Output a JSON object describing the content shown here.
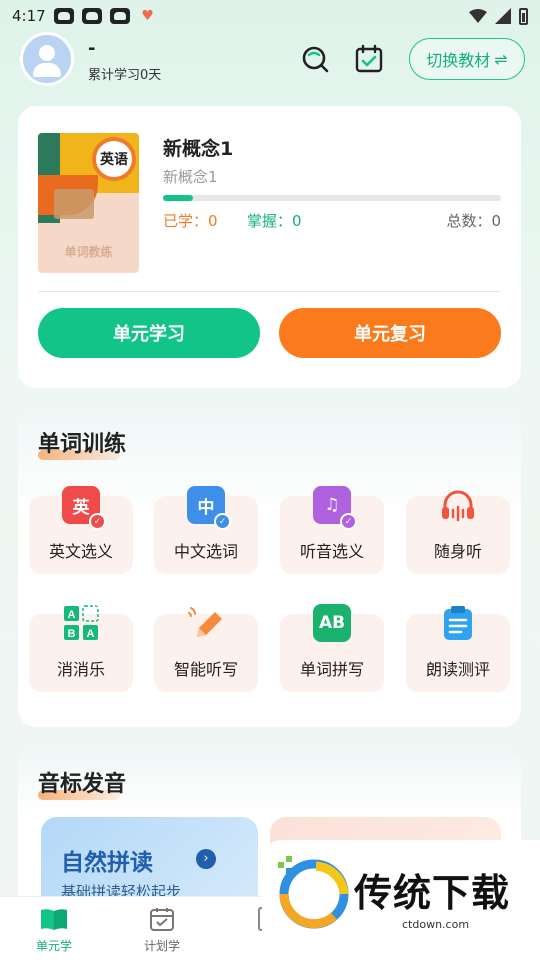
{
  "status_bar": {
    "time": "4:17",
    "heart_glyph": "♥"
  },
  "header": {
    "user_name": "-",
    "study_days": "累计学习0天",
    "switch_button": "切换教材",
    "switch_glyph": "⇌"
  },
  "book": {
    "cover_badge": "英语",
    "cover_title": "单词教练",
    "name": "新概念1",
    "subtitle": "新概念1",
    "progress_fraction": 0.09,
    "learned_text": "已学：0",
    "mastered_text": "掌握：0",
    "total_text": "总数：0",
    "study_button": "单元学习",
    "review_button": "单元复习"
  },
  "training": {
    "title": "单词训练",
    "items": [
      {
        "label": "英文选义",
        "icon_text": "英",
        "icon": "english-choose-icon",
        "color": "#f04a4a"
      },
      {
        "label": "中文选词",
        "icon_text": "中",
        "icon": "chinese-choose-icon",
        "color": "#3d8fea"
      },
      {
        "label": "听音选义",
        "icon_text": "♫",
        "icon": "listen-choose-icon",
        "color": "#b061e0"
      },
      {
        "label": "随身听",
        "icon_text": "",
        "icon": "headphone-icon",
        "color": "#f2553b"
      },
      {
        "label": "消消乐",
        "icon_text": "AB",
        "icon": "match-game-icon",
        "color": "#15b97a"
      },
      {
        "label": "智能听写",
        "icon_text": "",
        "icon": "pencil-icon",
        "color": "#f58a3a"
      },
      {
        "label": "单词拼写",
        "icon_text": "AB",
        "icon": "spelling-icon",
        "color": "#1ab36d"
      },
      {
        "label": "朗读测评",
        "icon_text": "",
        "icon": "clipboard-icon",
        "color": "#2fa3ef"
      }
    ]
  },
  "phonetic": {
    "title": "音标发音",
    "promo_title": "自然拼读",
    "promo_sub": "基础拼读轻松起步"
  },
  "bottom_nav": {
    "items": [
      {
        "label": "单元学",
        "icon": "book-icon"
      },
      {
        "label": "计划学",
        "icon": "calendar-plan-icon"
      }
    ]
  },
  "watermark": {
    "text": "传统下载",
    "url": "ctdown.com"
  },
  "colors": {
    "primary_green": "#13c488",
    "accent_orange": "#fb7a1b"
  }
}
